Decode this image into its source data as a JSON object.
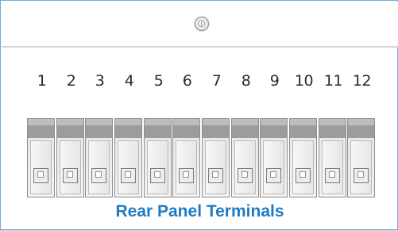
{
  "panel": {
    "ground_symbol": "ground-terminal-icon",
    "terminal_labels": [
      "1",
      "2",
      "3",
      "4",
      "5",
      "6",
      "7",
      "8",
      "9",
      "10",
      "11",
      "12"
    ],
    "caption": "Rear Panel Terminals",
    "colors": {
      "border": "#6aaedc",
      "caption": "#1f7bc4",
      "terminal_body": "#f2f2f2",
      "terminal_cap": "#9c9c9c"
    }
  }
}
